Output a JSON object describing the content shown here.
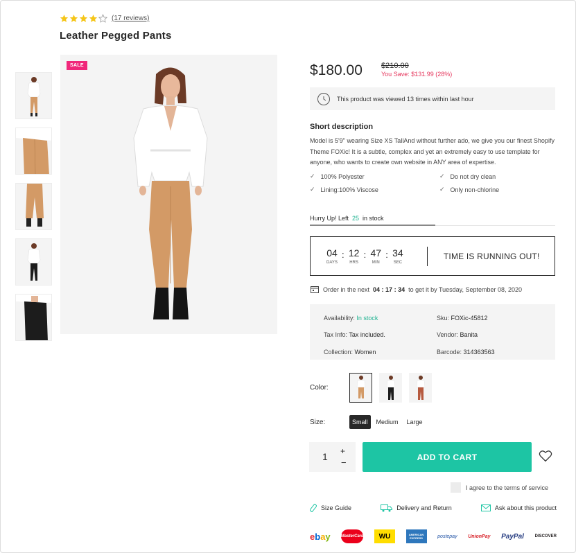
{
  "product": {
    "rating": 4,
    "max_rating": 5,
    "reviews_text": "(17 reviews)",
    "title": "Leather Pegged Pants",
    "sale_badge": "SALE",
    "thumbnails": [
      "model-front-white-top",
      "pants-side-closeup",
      "pants-back",
      "model-black-pants",
      "black-pants-closeup"
    ]
  },
  "price": {
    "current": "$180.00",
    "old": "$210.00",
    "you_save": "You Save: $131.99 (28%)"
  },
  "viewed": {
    "text": "This product was viewed 13 times within last hour"
  },
  "short_description": {
    "title": "Short description",
    "text": "Model is 5'9\" wearing Size XS TallAnd without further ado, we give you our finest Shopify Theme FOXic! It is a subtle, complex and yet an extremely easy to use template for anyone, who wants to create own website in ANY area of expertise.",
    "features": [
      "100% Polyester",
      "Do not dry clean",
      "Lining:100% Viscose",
      "Only non-chlorine"
    ]
  },
  "stock": {
    "prefix": "Hurry Up! Left",
    "count": "25",
    "suffix": "in stock",
    "fill_fraction": 0.51
  },
  "countdown": {
    "days": "04",
    "days_label": "DAYS",
    "hrs": "12",
    "hrs_label": "HRS",
    "min": "47",
    "min_label": "MIN",
    "sec": "34",
    "sec_label": "SEC",
    "message": "TIME IS RUNNING OUT!"
  },
  "order": {
    "prefix": "Order in the next",
    "time": "04 : 17 : 34",
    "suffix": "to get it by Tuesday, September 08, 2020"
  },
  "info": {
    "availability_label": "Availability:",
    "availability_value": "In stock",
    "sku_label": "Sku:",
    "sku_value": "FOXic-45812",
    "tax_label": "Tax Info:",
    "tax_value": "Tax included.",
    "vendor_label": "Vendor:",
    "vendor_value": "Banita",
    "collection_label": "Collection:",
    "collection_value": "Women",
    "barcode_label": "Barcode:",
    "barcode_value": "314363563"
  },
  "options": {
    "color_label": "Color:",
    "size_label": "Size:",
    "sizes": [
      "Small",
      "Medium",
      "Large"
    ],
    "selected_size": "Small"
  },
  "cart": {
    "quantity": "1",
    "plus": "+",
    "minus": "−",
    "add_label": "ADD TO CART",
    "terms": "I agree to the terms of service"
  },
  "links": {
    "size_guide": "Size Guide",
    "delivery": "Delivery and Return",
    "ask": "Ask about this product"
  },
  "payments": [
    "ebay",
    "MasterCard",
    "WU",
    "AMERICAN EXPRESS",
    "postepay",
    "UnionPay",
    "PayPal",
    "DISCOVER"
  ],
  "colors": {
    "accent": "#1dc5a4",
    "sale": "#f0277a",
    "save": "#e5345b",
    "star": "#f5c518"
  }
}
